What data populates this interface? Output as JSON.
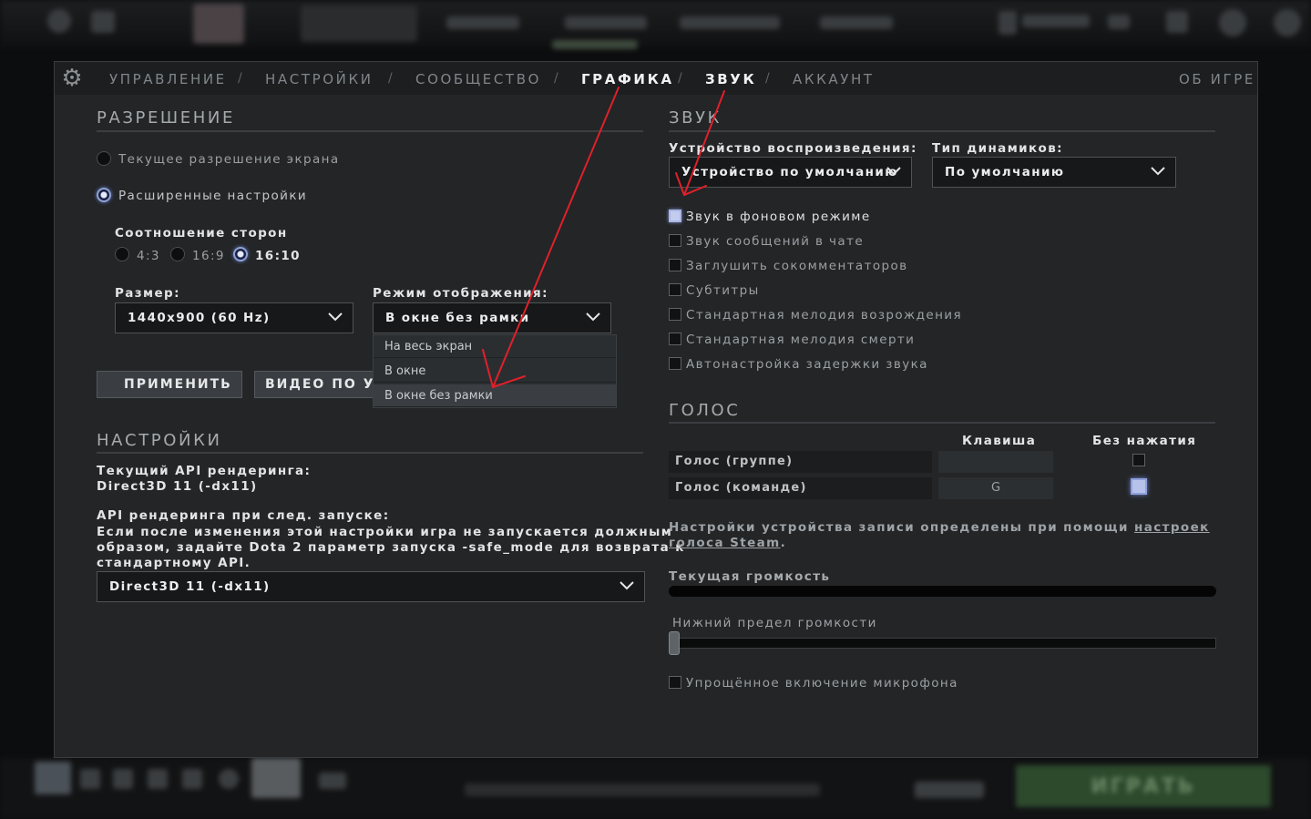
{
  "nav": {
    "items": [
      "УПРАВЛЕНИЕ",
      "НАСТРОЙКИ",
      "СООБЩЕСТВО",
      "ГРАФИКА",
      "ЗВУК",
      "АККАУНТ"
    ],
    "separator": "/",
    "about": "ОБ ИГРЕ",
    "active": [
      "ГРАФИКА",
      "ЗВУК"
    ]
  },
  "resolution": {
    "title": "РАЗРЕШЕНИЕ",
    "current_label": "Текущее разрешение экрана",
    "advanced_label": "Расширенные настройки",
    "selected": "advanced",
    "aspect_label": "Соотношение сторон",
    "aspects": [
      "4:3",
      "16:9",
      "16:10"
    ],
    "aspect_selected": "16:10",
    "size_label": "Размер:",
    "size_value": "1440x900 (60 Hz)",
    "mode_label": "Режим отображения:",
    "mode_value": "В окне без рамки",
    "mode_options": [
      "На весь экран",
      "В окне",
      "В окне без рамки"
    ],
    "apply": "ПРИМЕНИТЬ",
    "video_default": "ВИДЕО ПО УМОЛЧАНИЮ"
  },
  "settings": {
    "title": "НАСТРОЙКИ",
    "api_current_label": "Текущий API рендеринга:",
    "api_current_value": "Direct3D 11 (-dx11)",
    "api_next_label": "API рендеринга при след. запуске:",
    "api_note_1": "Если после изменения этой настройки игра не запускается должным",
    "api_note_2": "образом, задайте Dota 2 параметр запуска -safe_mode для возврата к",
    "api_note_3": "стандартному API.",
    "api_select": "Direct3D 11 (-dx11)"
  },
  "sound": {
    "title": "ЗВУК",
    "device_label": "Устройство воспроизведения:",
    "device_value": "Устройство по умолчанию",
    "speakers_label": "Тип динамиков:",
    "speakers_value": "По умолчанию",
    "options": [
      {
        "label": "Звук в фоновом режиме",
        "checked": true
      },
      {
        "label": "Звук сообщений в чате",
        "checked": false
      },
      {
        "label": "Заглушить сокомментаторов",
        "checked": false
      },
      {
        "label": "Субтитры",
        "checked": false
      },
      {
        "label": "Стандартная мелодия возрождения",
        "checked": false
      },
      {
        "label": "Стандартная мелодия смерти",
        "checked": false
      },
      {
        "label": "Автонастройка задержки звука",
        "checked": false
      }
    ]
  },
  "voice": {
    "title": "ГОЛОС",
    "col_key": "Клавиша",
    "col_open": "Без нажатия",
    "rows": [
      {
        "label": "Голос (группе)",
        "key": "",
        "open_mic": false
      },
      {
        "label": "Голос (команде)",
        "key": "G",
        "open_mic": true
      }
    ],
    "note_1": "Настройки устройства записи определены при помощи",
    "note_link_1": "настроек",
    "note_link_2": "голоса Steam",
    "note_end": ".",
    "current_volume": "Текущая громкость",
    "lower_limit": "Нижний предел громкости",
    "lower_limit_value": 0,
    "simple_mic": "Упрощённое включение микрофона"
  },
  "background": {
    "play": "ИГРАТЬ"
  },
  "colors": {
    "annotation": "#e0202a",
    "panel": "#232527",
    "active_glow": "#8fa3d8"
  }
}
